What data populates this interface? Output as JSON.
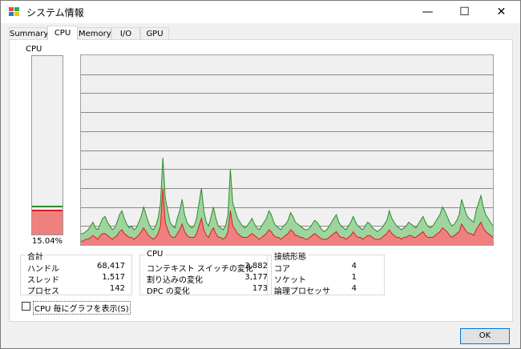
{
  "window": {
    "title": "システム情報"
  },
  "controls": {
    "minimize": "—",
    "maximize": "☐",
    "close": "✕"
  },
  "tabs": [
    {
      "label": "Summary",
      "active": false
    },
    {
      "label": "CPU",
      "active": true
    },
    {
      "label": "Memory",
      "active": false
    },
    {
      "label": "I/O",
      "active": false
    },
    {
      "label": "GPU",
      "active": false
    }
  ],
  "cpu": {
    "label": "CPU",
    "usage_percent_text": "15.04%",
    "usage_fraction": 0.1504
  },
  "history": {
    "total": [
      6,
      6,
      7,
      8,
      10,
      12,
      9,
      8,
      11,
      14,
      15,
      12,
      10,
      8,
      9,
      12,
      16,
      18,
      14,
      11,
      9,
      10,
      8,
      9,
      12,
      15,
      20,
      16,
      12,
      9,
      8,
      10,
      14,
      22,
      46,
      25,
      18,
      12,
      10,
      9,
      14,
      18,
      24,
      16,
      12,
      10,
      9,
      10,
      14,
      22,
      30,
      18,
      12,
      10,
      15,
      20,
      14,
      10,
      9,
      8,
      10,
      16,
      40,
      22,
      18,
      14,
      12,
      10,
      9,
      10,
      12,
      14,
      11,
      9,
      8,
      10,
      12,
      14,
      18,
      16,
      12,
      10,
      9,
      8,
      10,
      11,
      13,
      17,
      15,
      12,
      11,
      10,
      9,
      8,
      8,
      9,
      11,
      13,
      12,
      10,
      8,
      7,
      8,
      10,
      12,
      14,
      16,
      12,
      10,
      9,
      8,
      10,
      12,
      15,
      12,
      10,
      9,
      8,
      10,
      12,
      11,
      9,
      8,
      7,
      8,
      9,
      11,
      13,
      18,
      14,
      12,
      10,
      9,
      8,
      9,
      10,
      12,
      11,
      10,
      9,
      11,
      13,
      15,
      12,
      10,
      9,
      10,
      12,
      14,
      16,
      20,
      18,
      15,
      12,
      10,
      11,
      13,
      16,
      24,
      20,
      16,
      14,
      13,
      12,
      18,
      22,
      26,
      20,
      16,
      14,
      12,
      10
    ],
    "kernel": [
      2,
      2,
      3,
      3,
      4,
      5,
      4,
      3,
      5,
      6,
      6,
      5,
      4,
      3,
      4,
      5,
      7,
      8,
      6,
      5,
      4,
      4,
      3,
      4,
      5,
      7,
      9,
      7,
      5,
      4,
      3,
      4,
      6,
      10,
      30,
      12,
      8,
      5,
      4,
      4,
      6,
      8,
      11,
      7,
      5,
      4,
      4,
      4,
      6,
      10,
      14,
      8,
      5,
      4,
      7,
      9,
      6,
      4,
      4,
      3,
      4,
      7,
      18,
      10,
      8,
      6,
      5,
      4,
      4,
      4,
      5,
      6,
      5,
      4,
      3,
      4,
      5,
      6,
      8,
      7,
      5,
      4,
      4,
      3,
      4,
      5,
      6,
      8,
      7,
      5,
      5,
      4,
      4,
      3,
      3,
      4,
      5,
      6,
      5,
      4,
      3,
      3,
      3,
      4,
      5,
      6,
      7,
      5,
      4,
      4,
      3,
      4,
      5,
      7,
      5,
      4,
      4,
      3,
      4,
      5,
      5,
      4,
      3,
      3,
      3,
      4,
      5,
      6,
      8,
      6,
      5,
      4,
      4,
      3,
      4,
      4,
      5,
      5,
      4,
      4,
      5,
      6,
      7,
      5,
      4,
      4,
      4,
      5,
      6,
      7,
      9,
      8,
      7,
      5,
      4,
      5,
      6,
      7,
      11,
      9,
      7,
      6,
      6,
      5,
      8,
      10,
      12,
      9,
      7,
      6,
      5,
      4
    ]
  },
  "totals": {
    "title": "合計",
    "rows": [
      {
        "label": "ハンドル",
        "value": "68,417"
      },
      {
        "label": "スレッド",
        "value": "1,517"
      },
      {
        "label": "プロセス",
        "value": "142"
      }
    ]
  },
  "cpu_stats": {
    "title": "CPU",
    "rows": [
      {
        "label": "コンテキスト スイッチの変化",
        "value": "3,882"
      },
      {
        "label": "割り込みの変化",
        "value": "3,177"
      },
      {
        "label": "DPC の変化",
        "value": "173"
      }
    ]
  },
  "topology": {
    "title": "接続形態",
    "rows": [
      {
        "label": "コア",
        "value": "4"
      },
      {
        "label": "ソケット",
        "value": "1"
      },
      {
        "label": "論理プロセッサ",
        "value": "4"
      }
    ]
  },
  "options": {
    "per_cpu_checkbox": "CPU 毎にグラフを表示(S)",
    "per_cpu_checked": false
  },
  "buttons": {
    "ok": "OK"
  },
  "colors": {
    "user": "#9fd49f",
    "user_line": "#2e8b2e",
    "kernel": "#f08080",
    "kernel_line": "#d62020"
  }
}
